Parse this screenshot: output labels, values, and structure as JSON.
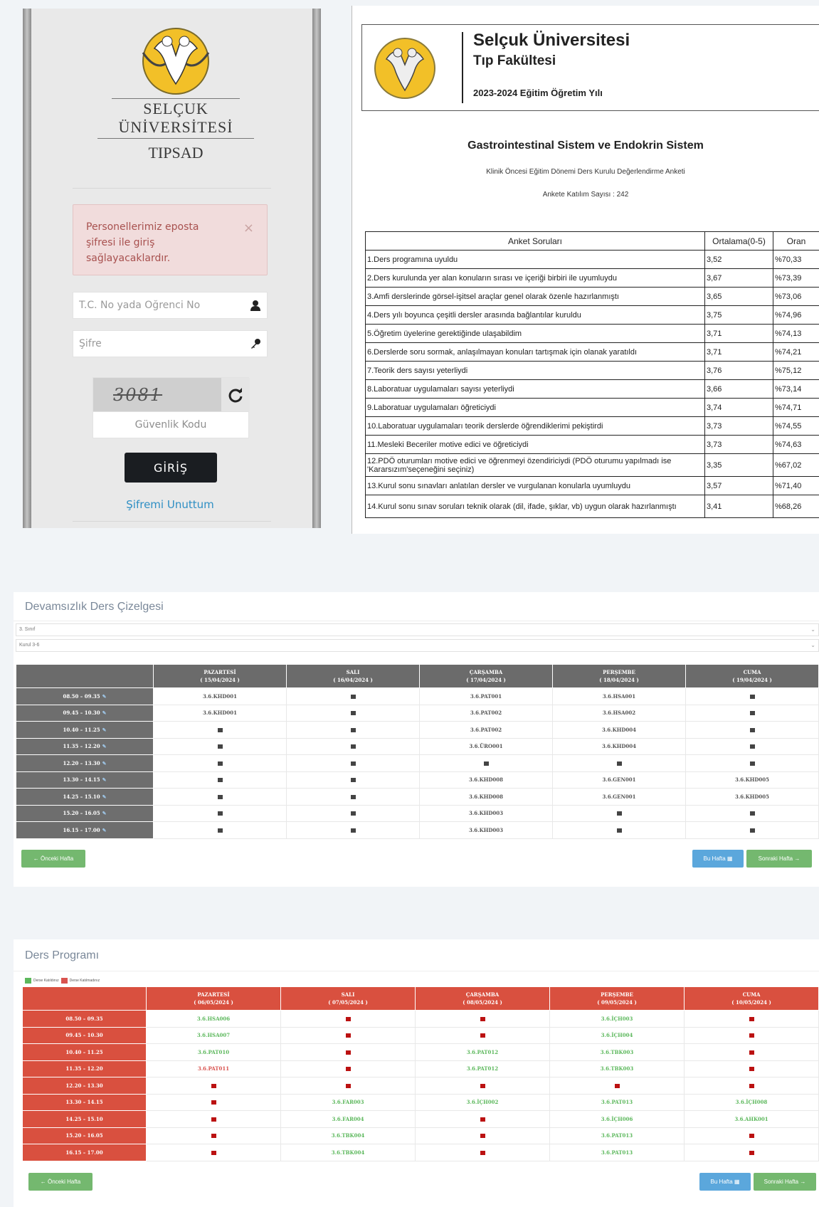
{
  "login": {
    "brand_line1": "SELÇUK",
    "brand_line2": "ÜNİVERSİTESİ",
    "brand_line3": "TIPSAD",
    "alert_text": "Personellerimiz eposta şifresi ile giriş sağlayacaklardır.",
    "alert_close": "×",
    "id_placeholder": "T.C. No yada Öğrenci No",
    "password_placeholder": "Şifre",
    "captcha_text": "3081",
    "captcha_placeholder": "Güvenlik Kodu",
    "login_button": "GİRİŞ",
    "forgot_link": "Şifremi Unuttum"
  },
  "survey": {
    "university": "Selçuk Üniversitesi",
    "faculty": "Tıp Fakültesi",
    "year": "2023-2024 Eğitim Öğretim Yılı",
    "course": "Gastrointestinal Sistem ve Endokrin Sistem",
    "subtitle": "Klinik Öncesi Eğitim Dönemi Ders Kurulu Değerlendirme Anketi",
    "participants": "Ankete Katılım Sayısı : 242",
    "headers": [
      "Anket Soruları",
      "Ortalama(0-5)",
      "Oran"
    ],
    "rows": [
      [
        "1.Ders programına uyuldu",
        "3,52",
        "%70,33"
      ],
      [
        "2.Ders kurulunda yer alan konuların sırası ve içeriği birbiri ile uyumluydu",
        "3,67",
        "%73,39"
      ],
      [
        "3.Amfi derslerinde görsel-işitsel araçlar genel olarak özenle hazırlanmıştı",
        "3,65",
        "%73,06"
      ],
      [
        "4.Ders yılı boyunca çeşitli dersler arasında bağlantılar kuruldu",
        "3,75",
        "%74,96"
      ],
      [
        "5.Öğretim üyelerine gerektiğinde ulaşabildim",
        "3,71",
        "%74,13"
      ],
      [
        "6.Derslerde soru sormak, anlaşılmayan konuları tartışmak için olanak yaratıldı",
        "3,71",
        "%74,21"
      ],
      [
        "7.Teorik ders sayısı yeterliydi",
        "3,76",
        "%75,12"
      ],
      [
        "8.Laboratuar uygulamaları sayısı yeterliydi",
        "3,66",
        "%73,14"
      ],
      [
        "9.Laboratuar uygulamaları öğreticiydi",
        "3,74",
        "%74,71"
      ],
      [
        "10.Laboratuar uygulamaları teorik derslerde öğrendiklerimi pekiştirdi",
        "3,73",
        "%74,55"
      ],
      [
        "11.Mesleki Beceriler motive edici ve öğreticiydi",
        "3,73",
        "%74,63"
      ],
      [
        "12.PDÖ oturumları motive edici ve öğrenmeyi özendiriciydi (PDÖ oturumu yapılmadı ise 'Kararsızım'seçeneğini seçiniz)",
        "3,35",
        "%67,02"
      ],
      [
        "13.Kurul sonu sınavları anlatılan dersler ve vurgulanan konularla uyumluydu",
        "3,57",
        "%71,40"
      ],
      [
        "14.Kurul sonu sınav soruları teknik olarak (dil, ifade, şıklar, vb) uygun olarak hazırlanmıştı",
        "3,41",
        "%68,26"
      ]
    ]
  },
  "attendance": {
    "title": "Devamsızlık Ders Çizelgesi",
    "select_class": "3. Sınıf",
    "select_board": "Kurul 3-6",
    "days": [
      [
        "PAZARTESİ",
        "( 15/04/2024 )"
      ],
      [
        "SALI",
        "( 16/04/2024 )"
      ],
      [
        "ÇARŞAMBA",
        "( 17/04/2024 )"
      ],
      [
        "PERŞEMBE",
        "( 18/04/2024 )"
      ],
      [
        "CUMA",
        "( 19/04/2024 )"
      ]
    ],
    "times": [
      "08.50 – 09.35",
      "09.45 – 10.30",
      "10.40 – 11.25",
      "11.35 – 12.20",
      "12.20 – 13.30",
      "13.30 – 14.15",
      "14.25 – 15.10",
      "15.20 – 16.05",
      "16.15 – 17.00"
    ],
    "cells": [
      [
        "3.6.KHD001",
        "",
        "3.6.PAT001",
        "3.6.HSA001",
        ""
      ],
      [
        "3.6.KHD001",
        "",
        "3.6.PAT002",
        "3.6.HSA002",
        ""
      ],
      [
        "",
        "",
        "3.6.PAT002",
        "3.6.KHD004",
        ""
      ],
      [
        "",
        "",
        "3.6.ÜRO001",
        "3.6.KHD004",
        ""
      ],
      [
        "",
        "",
        "",
        "",
        ""
      ],
      [
        "",
        "",
        "3.6.KHD008",
        "3.6.GEN001",
        "3.6.KHD005"
      ],
      [
        "",
        "",
        "3.6.KHD008",
        "3.6.GEN001",
        "3.6.KHD005"
      ],
      [
        "",
        "",
        "3.6.KHD003",
        "",
        ""
      ],
      [
        "",
        "",
        "3.6.KHD003",
        "",
        ""
      ]
    ],
    "prev_button": "← Önceki Hafta",
    "this_week_button": "Bu Hafta",
    "next_button": "Sonraki Hafta →"
  },
  "program": {
    "title": "Ders Programı",
    "legend_attended": "Derse Katıldınız",
    "legend_missed": "Derse Katılmadınız",
    "days": [
      [
        "PAZARTESİ",
        "( 06/05/2024 )"
      ],
      [
        "SALI",
        "( 07/05/2024 )"
      ],
      [
        "ÇARŞAMBA",
        "( 08/05/2024 )"
      ],
      [
        "PERŞEMBE",
        "( 09/05/2024 )"
      ],
      [
        "CUMA",
        "( 10/05/2024 )"
      ]
    ],
    "times": [
      "08.50 – 09.35",
      "09.45 – 10.30",
      "10.40 – 11.25",
      "11.35 – 12.20",
      "12.20 – 13.30",
      "13.30 – 14.15",
      "14.25 – 15.10",
      "15.20 – 16.05",
      "16.15 – 17.00"
    ],
    "cells": [
      [
        [
          "3.6.HSA006",
          "g"
        ],
        [
          "",
          ""
        ],
        [
          "",
          ""
        ],
        [
          "3.6.İÇH003",
          "g"
        ],
        [
          "",
          ""
        ]
      ],
      [
        [
          "3.6.HSA007",
          "g"
        ],
        [
          "",
          ""
        ],
        [
          "",
          ""
        ],
        [
          "3.6.İÇH004",
          "g"
        ],
        [
          "",
          ""
        ]
      ],
      [
        [
          "3.6.PAT010",
          "g"
        ],
        [
          "",
          ""
        ],
        [
          "3.6.PAT012",
          "g"
        ],
        [
          "3.6.TBK003",
          "g"
        ],
        [
          "",
          ""
        ]
      ],
      [
        [
          "3.6.PAT011",
          "r"
        ],
        [
          "",
          ""
        ],
        [
          "3.6.PAT012",
          "g"
        ],
        [
          "3.6.TBK003",
          "g"
        ],
        [
          "",
          ""
        ]
      ],
      [
        [
          "",
          ""
        ],
        [
          "",
          ""
        ],
        [
          "",
          ""
        ],
        [
          "",
          ""
        ],
        [
          "",
          ""
        ]
      ],
      [
        [
          "",
          ""
        ],
        [
          "3.6.FAR003",
          "g"
        ],
        [
          "3.6.İÇH002",
          "g"
        ],
        [
          "3.6.PAT013",
          "g"
        ],
        [
          "3.6.İÇH008",
          "g"
        ]
      ],
      [
        [
          "",
          ""
        ],
        [
          "3.6.FAR004",
          "g"
        ],
        [
          "",
          ""
        ],
        [
          "3.6.İÇH006",
          "g"
        ],
        [
          "3.6.AHK001",
          "g"
        ]
      ],
      [
        [
          "",
          ""
        ],
        [
          "3.6.TBK004",
          "g"
        ],
        [
          "",
          ""
        ],
        [
          "3.6.PAT013",
          "g"
        ],
        [
          "",
          ""
        ]
      ],
      [
        [
          "",
          ""
        ],
        [
          "3.6.TBK004",
          "g"
        ],
        [
          "",
          ""
        ],
        [
          "3.6.PAT013",
          "g"
        ],
        [
          "",
          ""
        ]
      ]
    ],
    "prev_button": "← Önceki Hafta",
    "this_week_button": "Bu Hafta",
    "next_button": "Sonraki Hafta →"
  },
  "colors": {
    "program_red": "#d9503f",
    "attended_green": "#5cb85c",
    "missed_red": "#d9534f",
    "header_gray": "#6b6b6b",
    "link_blue": "#2f8fc4"
  }
}
